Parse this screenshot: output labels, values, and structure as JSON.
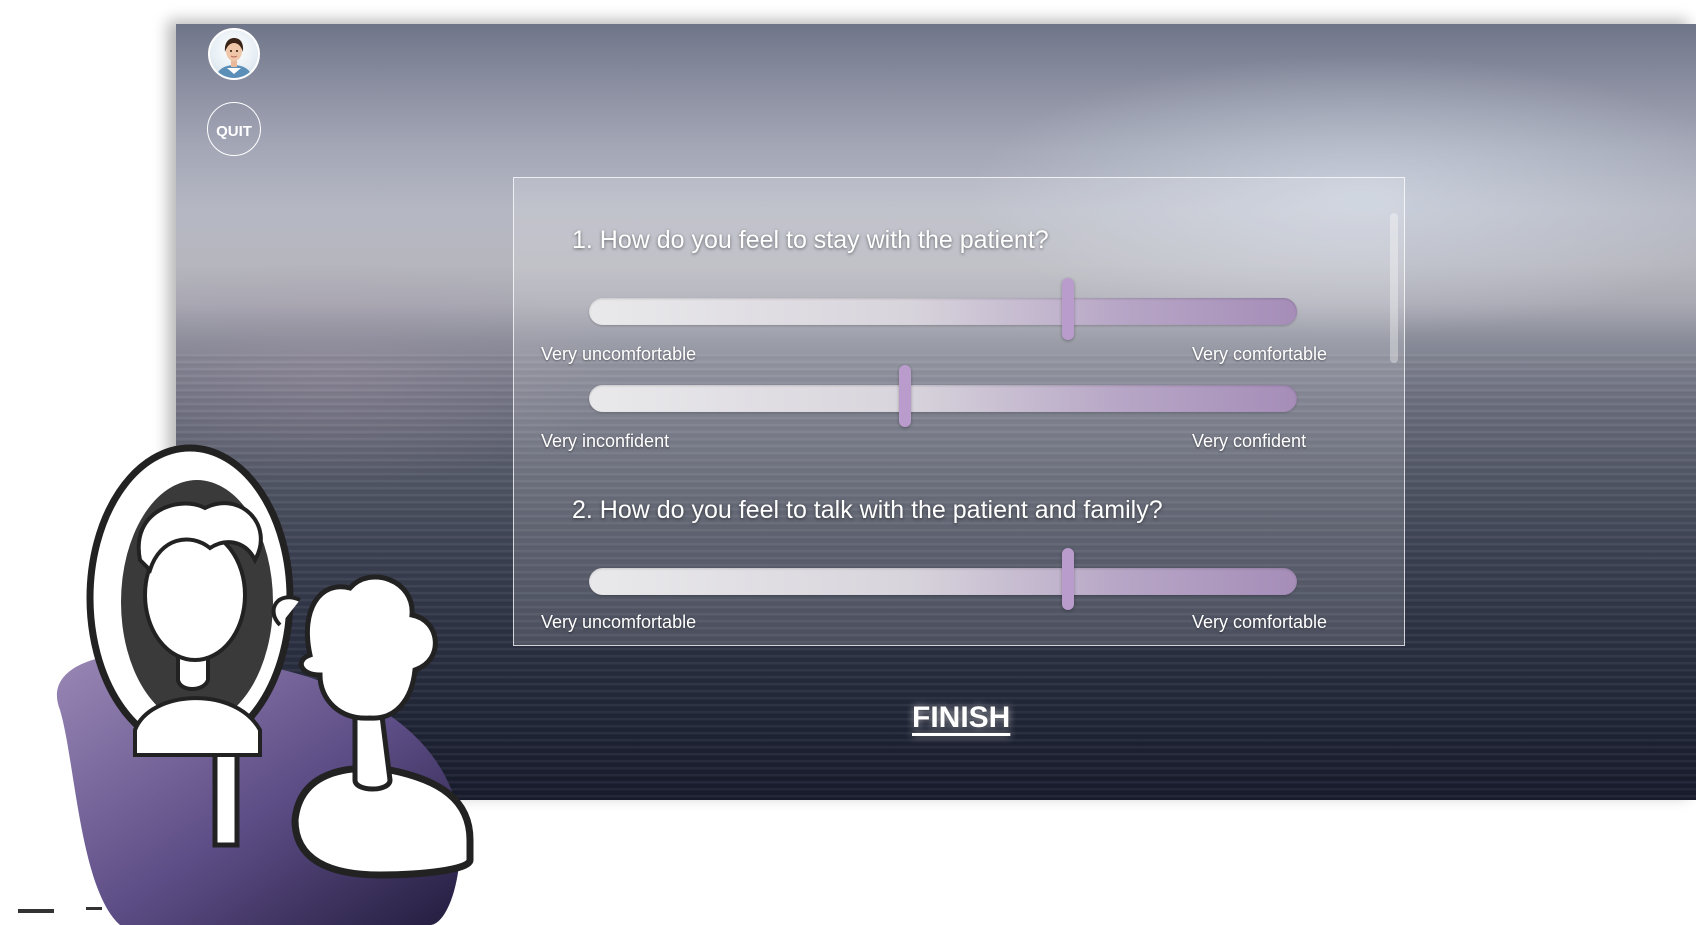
{
  "header": {
    "avatar_icon": "nurse-avatar-icon",
    "quit_label": "QUIT"
  },
  "survey": {
    "questions": [
      {
        "title": "1. How do you feel to stay with the patient?",
        "sliders": [
          {
            "value": 0.677,
            "min_label": "Very uncomfortable",
            "max_label": "Very comfortable"
          },
          {
            "value": 0.446,
            "min_label": "Very inconfident",
            "max_label": "Very confident"
          }
        ]
      },
      {
        "title": "2. How do you feel to talk with the patient and family?",
        "sliders": [
          {
            "value": 0.677,
            "min_label": "Very uncomfortable",
            "max_label": "Very comfortable"
          }
        ]
      }
    ]
  },
  "footer": {
    "finish_label": "FINISH"
  },
  "colors": {
    "accent": "#b99ccb",
    "track_start": "#e9e9eb",
    "track_end": "#a58db8",
    "mascot_base": "#3b2f5a"
  }
}
